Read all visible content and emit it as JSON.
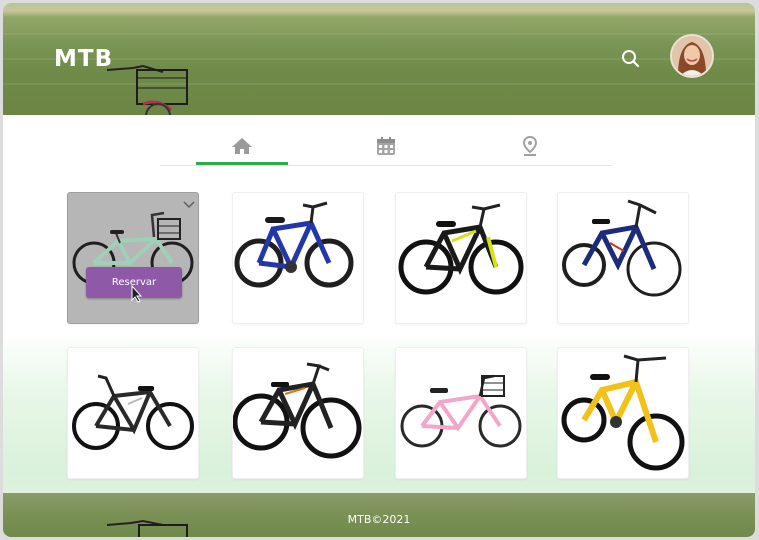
{
  "header": {
    "brand": "MTB",
    "search_icon": "search-icon",
    "avatar": "user-avatar"
  },
  "tabs": [
    {
      "icon": "home-icon",
      "active": true
    },
    {
      "icon": "calendar-icon",
      "active": false
    },
    {
      "icon": "location-pin-icon",
      "active": false
    }
  ],
  "colors": {
    "accent_green": "#2fa84a",
    "reserve_purple": "#8e5aa8",
    "hover_gray": "#b6b6b6"
  },
  "products": {
    "reserve_label": "Reservar",
    "items": [
      {
        "name": "mint-city-bike-basket",
        "frame": "#9fd0b8"
      },
      {
        "name": "blue-kids-mtb",
        "frame": "#2338a8"
      },
      {
        "name": "black-yellow-mtb",
        "frame": "#1a1a1a"
      },
      {
        "name": "blue-full-suspension",
        "frame": "#1c2b7a"
      },
      {
        "name": "black-mtb-gray",
        "frame": "#2a2a2a"
      },
      {
        "name": "black-orange-mtb",
        "frame": "#222222"
      },
      {
        "name": "pink-girls-bike",
        "frame": "#f2a6c8"
      },
      {
        "name": "yellow-full-suspension",
        "frame": "#f2c21a"
      }
    ]
  },
  "footer": {
    "text": "MTB©2021"
  }
}
